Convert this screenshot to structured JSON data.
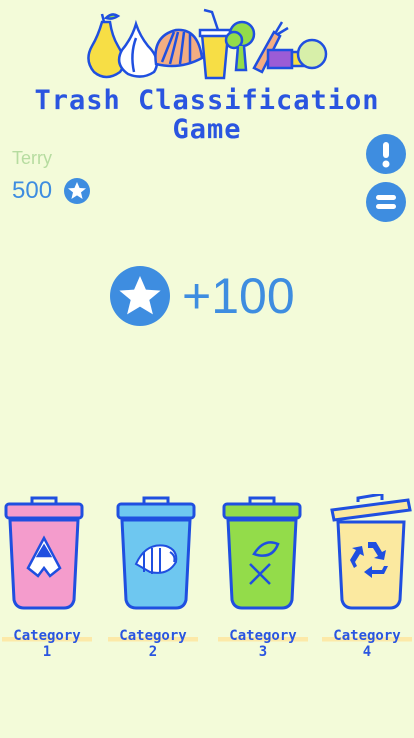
{
  "game": {
    "title_line1": "Trash Classification",
    "title_line2": "Game"
  },
  "player": {
    "name": "Terry",
    "score": "500",
    "score_icon": "star-icon"
  },
  "reward": {
    "text": "+100",
    "icon": "star-icon"
  },
  "buttons": {
    "info_icon": "exclamation-icon",
    "menu_icon": "equals-icon"
  },
  "bins": [
    {
      "label": "Category",
      "number": "1",
      "color": "#f49ccc",
      "icon": "broken-glass-icon"
    },
    {
      "label": "Category",
      "number": "2",
      "color": "#6ec7f0",
      "icon": "fish-bone-icon"
    },
    {
      "label": "Category",
      "number": "3",
      "color": "#93dc4a",
      "icon": "leaf-cross-icon"
    },
    {
      "label": "Category",
      "number": "4",
      "color": "#fbe9a0",
      "icon": "recycle-icon"
    }
  ],
  "colors": {
    "background": "#f3fbd9",
    "primary_blue": "#3e8de0",
    "title_blue": "#2a55e0",
    "outline_blue": "#1f4fe0"
  }
}
